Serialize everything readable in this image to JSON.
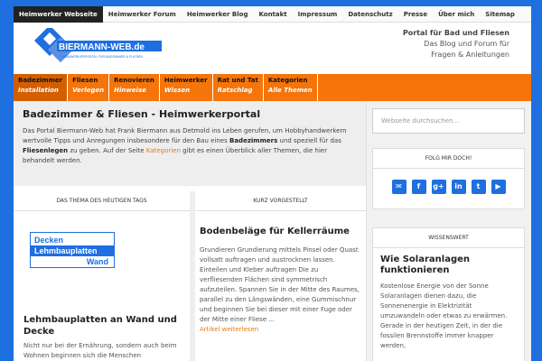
{
  "topnav": {
    "items": [
      "Heimwerker Webseite",
      "Heimwerker Forum",
      "Heimwerker Blog",
      "Kontakt",
      "Impressum",
      "Datenschutz",
      "Presse",
      "Über mich",
      "Sitemap"
    ]
  },
  "header": {
    "logo_text": "BIERMANN-WEB.de",
    "logo_sub": "HEIMWERKERPORTAL FÜR BADZIMMER & FLIESEN",
    "tagline_1": "Portal für Bad und Fliesen",
    "tagline_2": "Das Blog und Forum für",
    "tagline_3": "Fragen & Anleitungen"
  },
  "mainnav": {
    "items": [
      {
        "l1": "Badezimmer",
        "l2": "Installation"
      },
      {
        "l1": "Fliesen",
        "l2": "Verlegen"
      },
      {
        "l1": "Renovieren",
        "l2": "Hinweise"
      },
      {
        "l1": "Heimwerker",
        "l2": "Wissen"
      },
      {
        "l1": "Rat und Tat",
        "l2": "Ratschlag"
      },
      {
        "l1": "Kategorien",
        "l2": "Alle Themen"
      }
    ]
  },
  "intro": {
    "title": "Badezimmer & Fliesen - Heimwerkerportal",
    "p1": "Das Portal Biermann-Web hat Frank Biermann aus Detmold ins Leben gerufen, um Hobbyhandwerkern wertvolle Tipps und Anregungen insbesondere für den Bau eines",
    "b1": "Badezimmers",
    "p2": " und speziell für das ",
    "b2": "Fliesenlegen",
    "p3": " zu geben. Auf der Seite ",
    "link": "Kategorien",
    "p4": " gibt es einen Überblick aller Themen, die hier behandelt werden."
  },
  "col1": {
    "head": "DAS THEMA DES HEUTIGEN TAGS",
    "thumb_1": "Decken",
    "thumb_2": "Lehmbauplatten",
    "thumb_3": "Wand",
    "title": "Lehmbauplatten an Wand und Decke",
    "text": "Nicht nur bei der Ernährung, sondern auch beim Wohnen beginnen sich die Menschen"
  },
  "col2": {
    "head": "KURZ VORGESTELLT",
    "title": "Bodenbeläge für Kellerräume",
    "text": "Grundieren Grundierung mittels Pinsel oder Quast vollsatt auftragen und austrocknen lassen. Einteilen und Kleber auftragen Die zu verfliesenden Flächen sind symmetrisch aufzuteilen. Spannen Sie in der Mitte des Raumes, parallel zu den Längswänden, eine Gummischnur und beginnen Sie bei dieser mit einer Fuge oder der Mitte einer Fliese ...",
    "more": "Artikel weiterlesen"
  },
  "sidebar": {
    "search_placeholder": "Webseite durchsuchen...",
    "follow_head": "FOLG MIR DOCH!",
    "social": [
      {
        "icon": "mail-icon",
        "glyph": "✉"
      },
      {
        "icon": "facebook-icon",
        "glyph": "f"
      },
      {
        "icon": "googleplus-icon",
        "glyph": "g+"
      },
      {
        "icon": "linkedin-icon",
        "glyph": "in"
      },
      {
        "icon": "twitter-icon",
        "glyph": "t"
      },
      {
        "icon": "youtube-icon",
        "glyph": "▶"
      }
    ],
    "wiss_head": "WISSENSWERT",
    "wiss_title": "Wie Solaranlagen funktionieren",
    "wiss_text": "Kostenlose Energie von der Sonne Solaranlagen dienen dazu, die Sonnenenergie in Elektrizität umzuwandeln oder etwas zu erwärmen. Gerade in der heutigen Zeit, in der die fossilen Brennstoffe immer knapper werden,"
  },
  "colors": {
    "accent": "#f5750a",
    "brand": "#1e6fe0",
    "link": "#e87a0c"
  }
}
